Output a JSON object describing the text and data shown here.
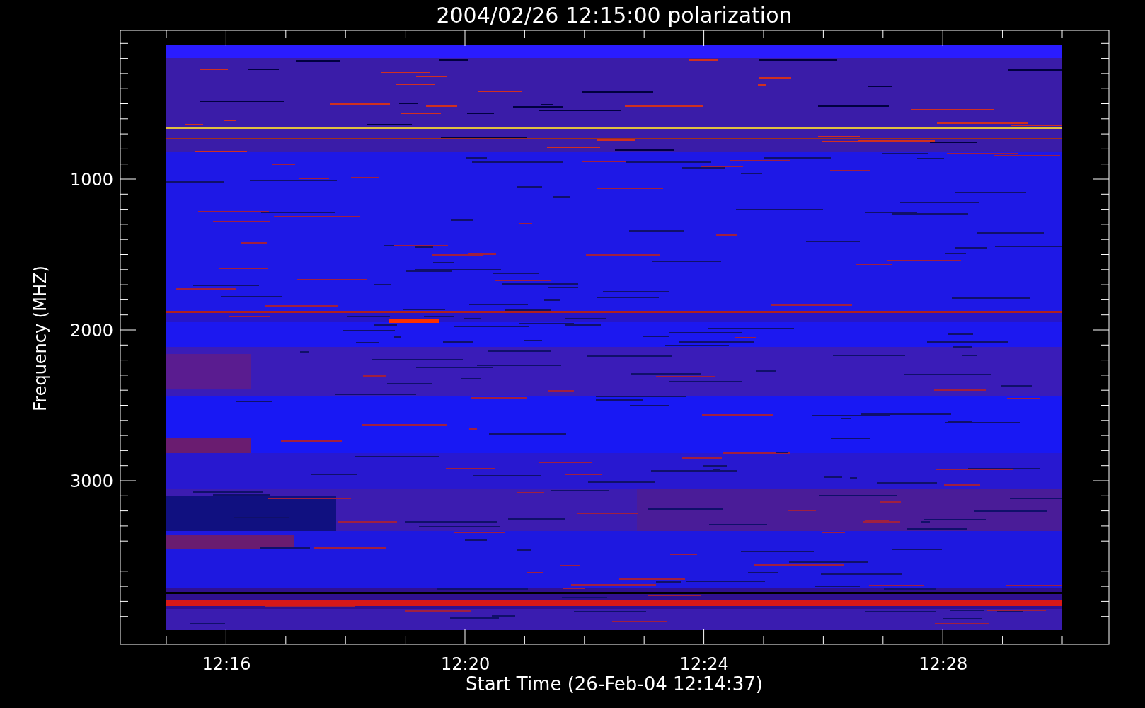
{
  "plot": {
    "title": "2004/02/26 12:15:00 polarization",
    "ylabel": "Frequency (MHZ)",
    "xlabel": "Start Time (26-Feb-04 12:14:37)",
    "xtick_labels": [
      "12:16",
      "12:20",
      "12:24",
      "12:28"
    ],
    "ytick_labels": [
      "1000",
      "2000",
      "3000"
    ]
  }
}
